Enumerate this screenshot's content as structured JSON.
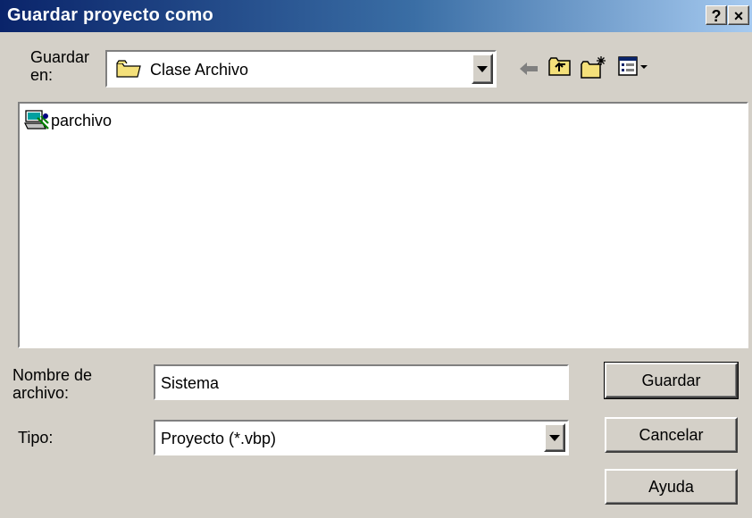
{
  "window": {
    "title": "Guardar proyecto como",
    "help_label": "?",
    "close_label": "×"
  },
  "location": {
    "label_line1": "Guardar",
    "label_line2": "en:",
    "value": "Clase Archivo",
    "folder_icon": "folder-icon"
  },
  "toolbar": {
    "back_icon": "back-arrow-icon",
    "up_icon": "up-folder-icon",
    "new_folder_icon": "new-folder-icon",
    "view_menu_icon": "view-menu-icon"
  },
  "files": [
    {
      "name": "parchivo",
      "icon": "vb-project-icon"
    }
  ],
  "filename": {
    "label_line1": "Nombre de",
    "label_line2": "archivo:",
    "value": "Sistema"
  },
  "filetype": {
    "label": "Tipo:",
    "value": "Proyecto (*.vbp)"
  },
  "buttons": {
    "save": "Guardar",
    "cancel": "Cancelar",
    "help": "Ayuda"
  },
  "colors": {
    "titlebar_start": "#0a246a",
    "titlebar_end": "#a6caf0",
    "face": "#d4d0c8"
  }
}
